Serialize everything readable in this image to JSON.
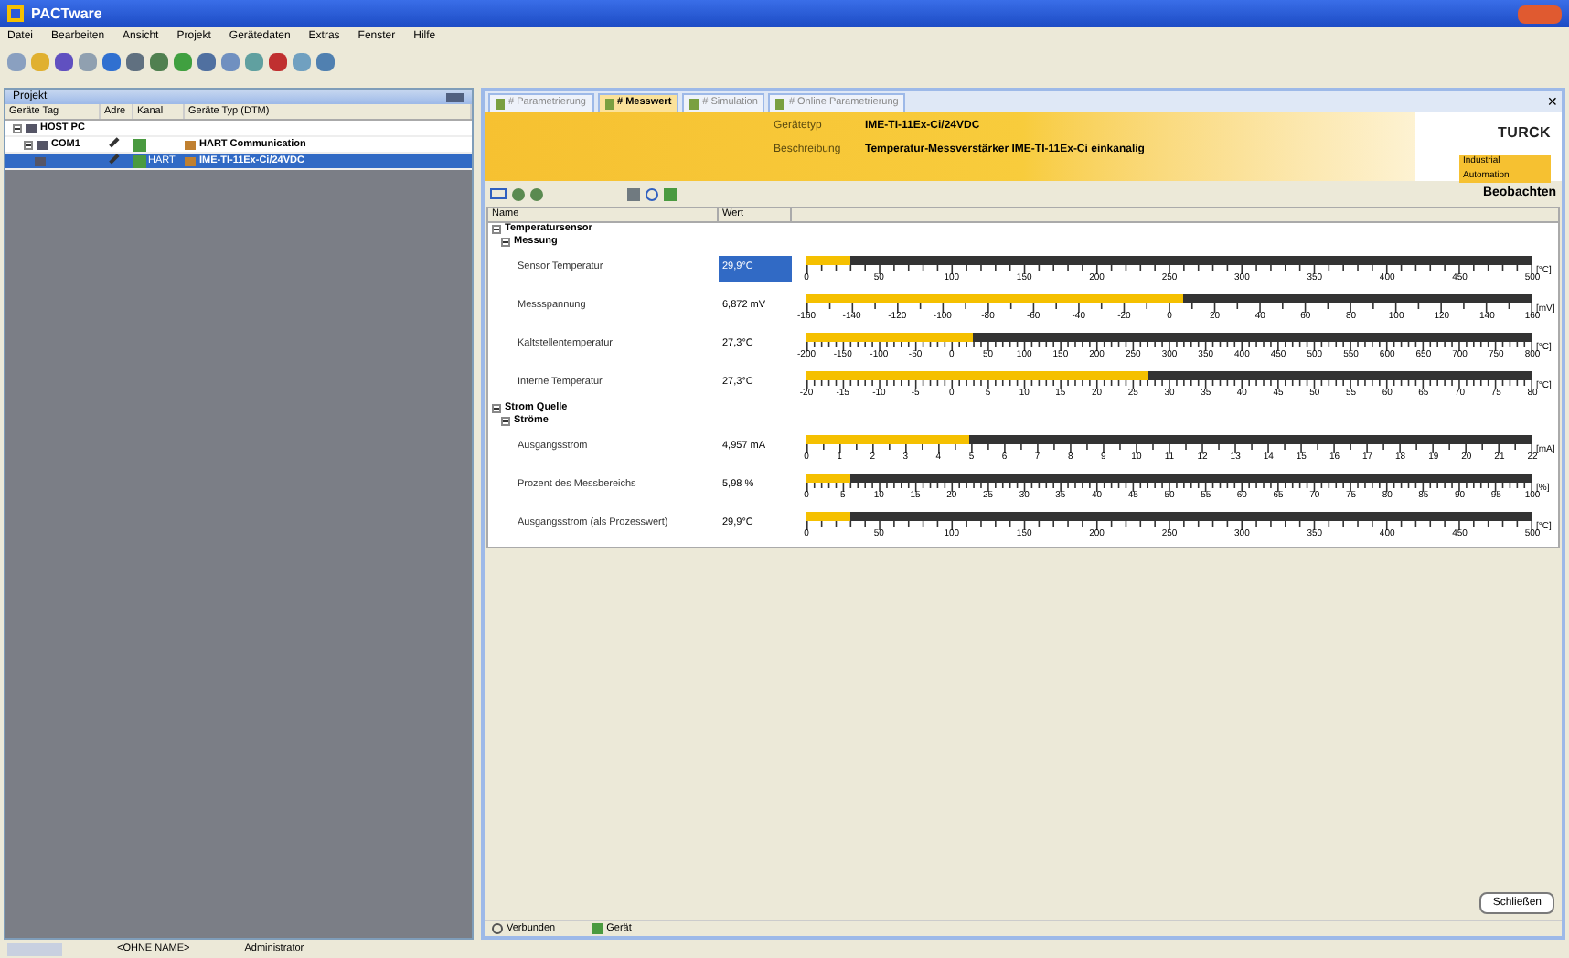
{
  "window": {
    "title": "PACTware"
  },
  "menu": [
    "Datei",
    "Bearbeiten",
    "Ansicht",
    "Projekt",
    "Gerätedaten",
    "Extras",
    "Fenster",
    "Hilfe"
  ],
  "project": {
    "title": "Projekt",
    "columns": [
      "Geräte Tag",
      "Adre",
      "Kanal",
      "Geräte Typ (DTM)"
    ],
    "rows": [
      {
        "tag": "HOST PC",
        "selected": false,
        "expanded": true,
        "children": [
          {
            "tag": "COM1",
            "type": "HART Communication",
            "selected": false,
            "expanded": true,
            "children": [
              {
                "channel": "HART",
                "type": "IME-TI-11Ex-Ci/24VDC",
                "selected": true
              }
            ]
          }
        ]
      }
    ]
  },
  "tabs": [
    {
      "label": "# Parametrierung",
      "selected": false
    },
    {
      "label": "# Messwert",
      "selected": true
    },
    {
      "label": "# Simulation",
      "selected": false
    },
    {
      "label": "# Online Parametrierung",
      "selected": false
    }
  ],
  "tab_close": "✕",
  "device_header": {
    "fields": [
      {
        "label": "Gerätetyp",
        "value": "IME-TI-11Ex-Ci/24VDC"
      },
      {
        "label": "Beschreibung",
        "value": "Temperatur-Messverstärker IME-TI-11Ex-Ci einkanalig"
      }
    ],
    "logo": "TURCK",
    "tagline": "Industrial Automation"
  },
  "toolbar_label": "Beobachten",
  "table": {
    "columns": [
      "Name",
      "Wert"
    ],
    "tree": [
      {
        "label": "Temperatursensor",
        "expanded": true,
        "children": [
          {
            "label": "Messung",
            "expanded": true,
            "children": [
              {
                "label": "Sensor Temperatur",
                "value": "29,9°C",
                "selected": true,
                "gauge": {
                  "level": 0.06,
                  "unit": "[°C]",
                  "scale": [
                    "0",
                    "50",
                    "100",
                    "150",
                    "200",
                    "250",
                    "300",
                    "350",
                    "400",
                    "450",
                    "500"
                  ]
                }
              },
              {
                "label": "Messspannung",
                "value": "6,872 mV",
                "selected": false,
                "gauge": {
                  "level": 0.52,
                  "unit": "[mV]",
                  "scale": [
                    "-160",
                    "-140",
                    "-120",
                    "-100",
                    "-80",
                    "-60",
                    "-40",
                    "-20",
                    "0",
                    "20",
                    "40",
                    "60",
                    "80",
                    "100",
                    "120",
                    "140",
                    "160"
                  ]
                }
              },
              {
                "label": "Kaltstellentemperatur",
                "value": "27,3°C",
                "selected": false,
                "gauge": {
                  "level": 0.23,
                  "unit": "[°C]",
                  "scale": [
                    "-200",
                    "-150",
                    "-100",
                    "-50",
                    "0",
                    "50",
                    "100",
                    "150",
                    "200",
                    "250",
                    "300",
                    "350",
                    "400",
                    "450",
                    "500",
                    "550",
                    "600",
                    "650",
                    "700",
                    "750",
                    "800"
                  ]
                }
              },
              {
                "label": "Interne Temperatur",
                "value": "27,3°C",
                "selected": false,
                "gauge": {
                  "level": 0.47,
                  "unit": "[°C]",
                  "scale": [
                    "-20",
                    "-15",
                    "-10",
                    "-5",
                    "0",
                    "5",
                    "10",
                    "15",
                    "20",
                    "25",
                    "30",
                    "35",
                    "40",
                    "45",
                    "50",
                    "55",
                    "60",
                    "65",
                    "70",
                    "75",
                    "80"
                  ]
                }
              }
            ]
          }
        ]
      },
      {
        "label": "Strom Quelle",
        "expanded": true,
        "children": [
          {
            "label": "Ströme",
            "expanded": true,
            "children": [
              {
                "label": "Ausgangsstrom",
                "value": "4,957 mA",
                "selected": false,
                "gauge": {
                  "level": 0.225,
                  "unit": "[mA]",
                  "scale": [
                    "0",
                    "1",
                    "2",
                    "3",
                    "4",
                    "5",
                    "6",
                    "7",
                    "8",
                    "9",
                    "10",
                    "11",
                    "12",
                    "13",
                    "14",
                    "15",
                    "16",
                    "17",
                    "18",
                    "19",
                    "20",
                    "21",
                    "22"
                  ]
                }
              },
              {
                "label": "Prozent des Messbereichs",
                "value": "5,98 %",
                "selected": false,
                "gauge": {
                  "level": 0.06,
                  "unit": "[%]",
                  "scale": [
                    "0",
                    "5",
                    "10",
                    "15",
                    "20",
                    "25",
                    "30",
                    "35",
                    "40",
                    "45",
                    "50",
                    "55",
                    "60",
                    "65",
                    "70",
                    "75",
                    "80",
                    "85",
                    "90",
                    "95",
                    "100"
                  ]
                }
              },
              {
                "label": "Ausgangsstrom (als Prozesswert)",
                "value": "29,9°C",
                "selected": false,
                "gauge": {
                  "level": 0.06,
                  "unit": "[°C]",
                  "scale": [
                    "0",
                    "50",
                    "100",
                    "150",
                    "200",
                    "250",
                    "300",
                    "350",
                    "400",
                    "450",
                    "500"
                  ]
                }
              }
            ]
          }
        ]
      }
    ]
  },
  "close_button": "Schließen",
  "status": [
    {
      "label": "Verbunden"
    },
    {
      "label": "Gerät"
    }
  ],
  "app_status": [
    "<OHNE NAME>",
    "Administrator"
  ]
}
